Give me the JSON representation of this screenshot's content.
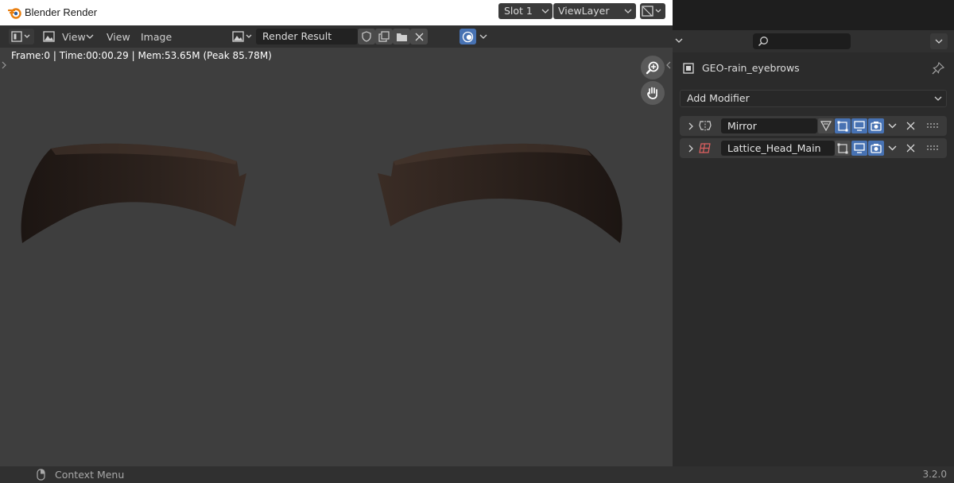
{
  "window": {
    "title": "Blender Render",
    "minimize_symbol": "—",
    "maximize_symbol": "☐",
    "close_symbol": "✕"
  },
  "image_editor": {
    "menu": {
      "view_dropdown": "View",
      "view": "View",
      "image": "Image"
    },
    "image_name": "Render Result",
    "slot": "Slot 1",
    "view_layer": "ViewLayer",
    "stats": "Frame:0 | Time:00:00.29 | Mem:53.65M (Peak 85.78M)"
  },
  "properties": {
    "object_name": "GEO-rain_eyebrows",
    "add_modifier_label": "Add Modifier",
    "modifiers": [
      {
        "name": "Mirror"
      },
      {
        "name": "Lattice_Head_Main"
      }
    ]
  },
  "statusbar": {
    "context_menu_label": "Context Menu",
    "version": "3.2.0"
  },
  "colors": {
    "accent_blue": "#4772b3",
    "blender_orange": "#e87d0d",
    "lattice_red": "#e06060",
    "eyebrow_dark": "#221a16"
  }
}
